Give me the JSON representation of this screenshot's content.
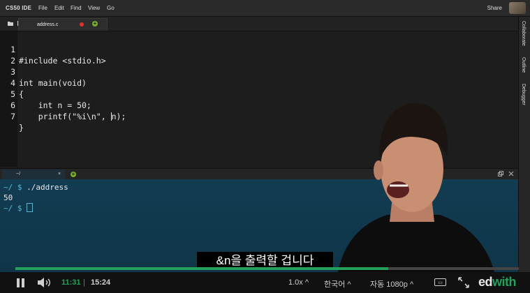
{
  "menubar": {
    "brand": "CS50 IDE",
    "menus": [
      "File",
      "Edit",
      "Find",
      "View",
      "Go"
    ],
    "share": "Share"
  },
  "editor": {
    "tab_label": "address.c",
    "lines": [
      {
        "n": "1",
        "text": "#include <stdio.h>"
      },
      {
        "n": "2",
        "text": ""
      },
      {
        "n": "3",
        "text": "int main(void)"
      },
      {
        "n": "4",
        "text": "{"
      },
      {
        "n": "5",
        "text": "    int n = 50;"
      },
      {
        "n": "6",
        "text": "    printf(\"%i\\n\", n);"
      },
      {
        "n": "7",
        "text": "}"
      }
    ]
  },
  "sidebar": {
    "panels": [
      "Collaborate",
      "Outline",
      "Debugger"
    ]
  },
  "terminal": {
    "tab_label": "~/",
    "close": "×",
    "prompt": "~/ $",
    "command": "./address",
    "output": "50"
  },
  "video": {
    "subtitle": "&n을 출력할 겁니다",
    "progress_fraction": 0.74,
    "current_time": "11:31",
    "separator": "|",
    "total_time": "15:24",
    "speed": "1.0x ^",
    "language": "한국어 ^",
    "quality": "자동 1080p ^",
    "logo_prefix": "ed",
    "logo_suffix": "with"
  },
  "colors": {
    "accent_green": "#24a05a",
    "keyword": "#c07bd4",
    "number": "#f29a4c",
    "terminal_bg": "#123c52"
  }
}
